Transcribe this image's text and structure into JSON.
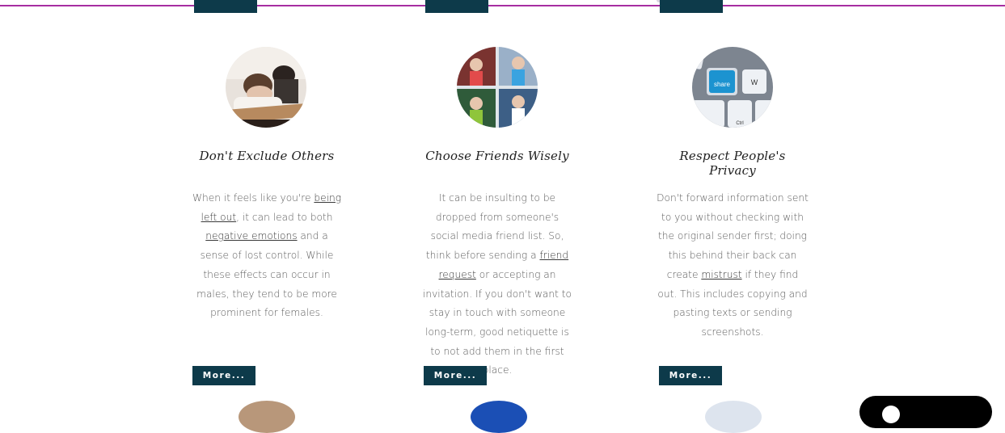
{
  "colors": {
    "accent_line": "#a72ea1",
    "button_bg": "#0d3a4a",
    "button_text": "#ffffff"
  },
  "cards": [
    {
      "title": "Don't Exclude Others",
      "image_icon": "students-sleeping-photo",
      "body_parts": [
        "When it feels like you're ",
        "being left out",
        ", it can lead to both ",
        "negative emotions",
        " and a sense of lost control. While these effects can occur in males, they tend to be more prominent for females."
      ],
      "button": "More..."
    },
    {
      "title": "Choose Friends Wisely",
      "image_icon": "friends-collage-photo",
      "body_parts": [
        "It can be insulting to be dropped from someone's social media friend list. So, think before sending a ",
        "friend request",
        " or accepting an invitation. If you don't want to stay in touch with someone long-term, good netiquette is to not add them in the first place."
      ],
      "button": "More..."
    },
    {
      "title": "Respect People's Privacy",
      "image_icon": "share-keyboard-photo",
      "body_parts": [
        "Don't forward information sent to you without checking with the original sender first; doing this behind their back can create ",
        "mistrust",
        " if they find out. This includes copying and pasting texts or sending screenshots."
      ],
      "button": "More..."
    }
  ],
  "keyboard_keys": {
    "share": "share",
    "w": "W",
    "ctrl": "Ctrl"
  }
}
